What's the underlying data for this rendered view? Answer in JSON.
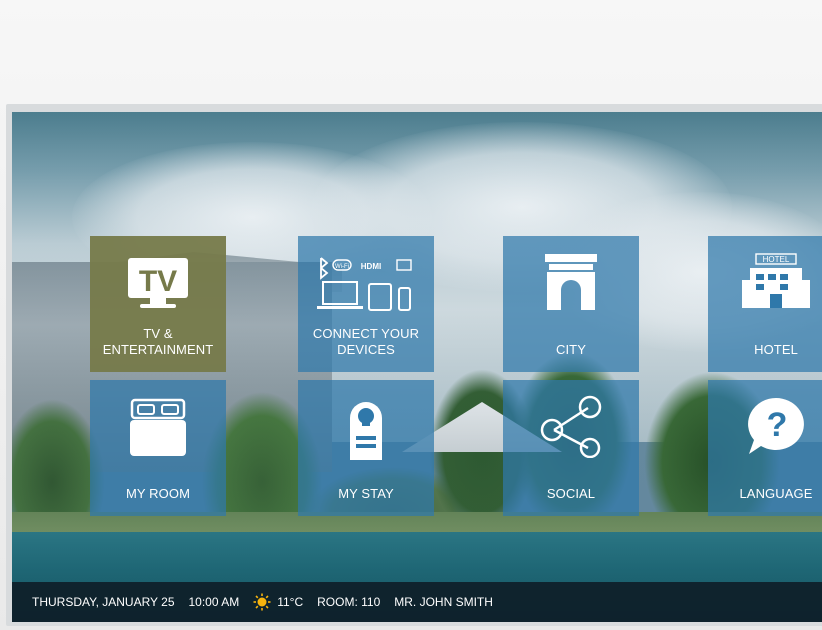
{
  "tiles": [
    {
      "id": "tv",
      "label": "TV &\nENTERTAINMENT",
      "icon": "tv-icon",
      "active": true,
      "icon_text": "TV"
    },
    {
      "id": "connect",
      "label": "CONNECT YOUR\nDEVICES",
      "icon": "devices-icon",
      "active": false,
      "icon_text": "HDMI"
    },
    {
      "id": "city",
      "label": "CITY",
      "icon": "arch-icon",
      "active": false
    },
    {
      "id": "hotel",
      "label": "HOTEL",
      "icon": "hotel-icon",
      "active": false,
      "icon_text": "HOTEL"
    },
    {
      "id": "my-room",
      "label": "MY ROOM",
      "icon": "bed-icon",
      "active": false
    },
    {
      "id": "my-stay",
      "label": "MY STAY",
      "icon": "door-hanger-icon",
      "active": false
    },
    {
      "id": "social",
      "label": "SOCIAL",
      "icon": "share-icon",
      "active": false
    },
    {
      "id": "language",
      "label": "LANGUAGE",
      "icon": "question-bubble-icon",
      "active": false,
      "icon_text": "?"
    }
  ],
  "status_bar": {
    "date": "THURSDAY, JANUARY 25",
    "time": "10:00 AM",
    "weather_icon": "sun-icon",
    "temperature": "11°C",
    "room": "ROOM: 110",
    "guest": "MR. JOHN SMITH"
  },
  "colors": {
    "tile_blue": "#2f78aa",
    "tile_active": "#767a4a",
    "status_bar": "#0e1e28",
    "sun": "#f6b40e"
  }
}
